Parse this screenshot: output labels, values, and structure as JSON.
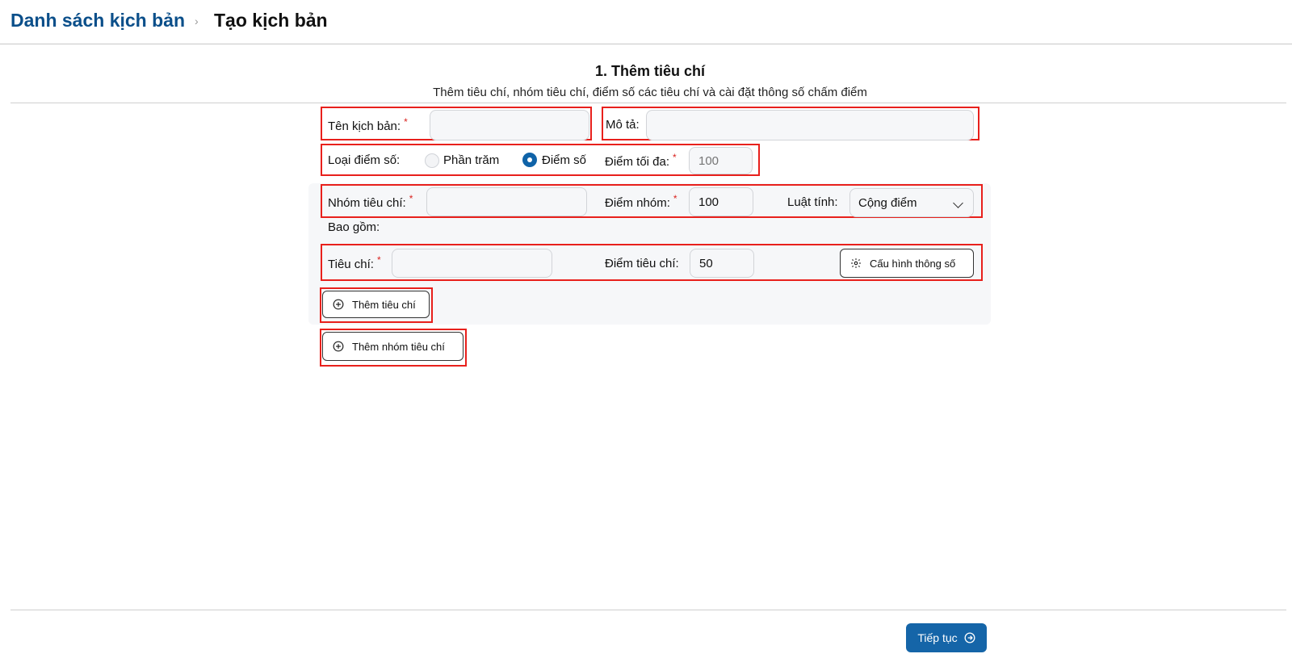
{
  "breadcrumb": {
    "parent": "Danh sách kịch bản",
    "separator": "›",
    "current": "Tạo kịch bản"
  },
  "step": {
    "title": "1. Thêm tiêu chí",
    "subtitle": "Thêm tiêu chí, nhóm tiêu chí, điểm số các tiêu chí và cài đặt thông số chấm điểm"
  },
  "form": {
    "scenario_name_label": "Tên kịch bản:",
    "scenario_name_value": "",
    "description_label": "Mô tả:",
    "description_value": "",
    "score_type_label": "Loại điểm số:",
    "score_type_options": [
      "Phần trăm",
      "Điểm số"
    ],
    "score_type_selected": "Điểm số",
    "max_score_label": "Điểm tối đa:",
    "max_score_placeholder": "100",
    "required_mark": "*"
  },
  "group": {
    "name_label": "Nhóm tiêu chí:",
    "name_value": "",
    "score_label": "Điểm nhóm:",
    "score_value": "100",
    "rule_label": "Luật tính:",
    "rule_value": "Cộng điểm",
    "includes_label": "Bao gồm:",
    "criterion_label": "Tiêu chí:",
    "criterion_value": "",
    "criterion_score_label": "Điểm tiêu chí:",
    "criterion_score_value": "50",
    "config_button": "Cấu hình thông số",
    "add_criterion_button": "Thêm tiêu chí"
  },
  "add_group_button": "Thêm nhóm tiêu chí",
  "footer": {
    "continue_button": "Tiếp tục"
  },
  "colors": {
    "brand": "#0b4f8a",
    "primary": "#1565a8",
    "highlight": "#e8201c",
    "required": "#d9231f"
  }
}
